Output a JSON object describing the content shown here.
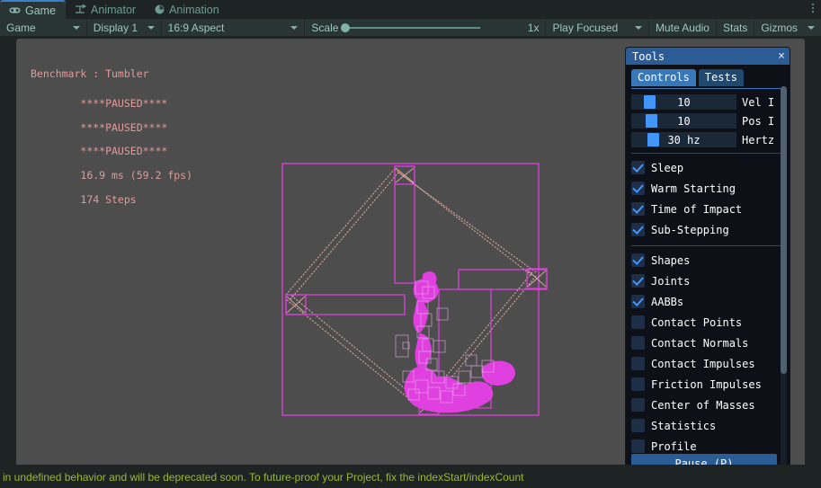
{
  "tabstrip": {
    "tabs": [
      {
        "label": "Game",
        "icon": "gamepad-icon",
        "active": true
      },
      {
        "label": "Animator",
        "icon": "animator-icon",
        "active": false
      },
      {
        "label": "Animation",
        "icon": "clock-icon",
        "active": false
      }
    ],
    "overflow_menu": "more-options-icon"
  },
  "toolbar": {
    "view_selector": "Game",
    "display_selector": "Display 1",
    "aspect_selector": "16:9 Aspect",
    "scale_label": "Scale",
    "scale_value": "1x",
    "play_mode": "Play Focused",
    "mute_audio": "Mute Audio",
    "stats": "Stats",
    "gizmos": "Gizmos"
  },
  "hud": {
    "title": "Benchmark : Tumbler",
    "lines": [
      "****PAUSED****",
      "****PAUSED****",
      "****PAUSED****",
      "16.9 ms (59.2 fps)",
      "174 Steps"
    ]
  },
  "tools": {
    "title": "Tools",
    "close_label": "×",
    "tabs": [
      {
        "label": "Controls",
        "active": true
      },
      {
        "label": "Tests",
        "active": false
      }
    ],
    "sliders": [
      {
        "value": "10",
        "label": "Vel I"
      },
      {
        "value": "10",
        "label": "Pos I"
      },
      {
        "value": "30 hz",
        "label": "Hertz"
      }
    ],
    "checkgroups": [
      [
        {
          "label": "Sleep",
          "checked": true
        },
        {
          "label": "Warm Starting",
          "checked": true
        },
        {
          "label": "Time of Impact",
          "checked": true
        },
        {
          "label": "Sub-Stepping",
          "checked": true
        }
      ],
      [
        {
          "label": "Shapes",
          "checked": true
        },
        {
          "label": "Joints",
          "checked": true
        },
        {
          "label": "AABBs",
          "checked": true
        },
        {
          "label": "Contact Points",
          "checked": false
        },
        {
          "label": "Contact Normals",
          "checked": false
        },
        {
          "label": "Contact Impulses",
          "checked": false
        },
        {
          "label": "Friction Impulses",
          "checked": false
        },
        {
          "label": "Center of Masses",
          "checked": false
        },
        {
          "label": "Statistics",
          "checked": false
        },
        {
          "label": "Profile",
          "checked": false
        }
      ]
    ],
    "pause_button": "Pause (P)"
  },
  "statusbar": {
    "message": "in undefined behavior and will be deprecated soon. To future-proof your Project, fix the indexStart/indexCount"
  },
  "colors": {
    "unity_panel": "#293534",
    "unity_bg": "#1d2423",
    "tab_accent": "#3a7fd0",
    "game_bg": "#4d4d4d",
    "hud_text": "#e39a9a",
    "debug_magenta": "#e040e0",
    "debug_joint": "#d8a8a0",
    "imgui_blue": "#4296fa",
    "status_text": "#9aba2a"
  }
}
